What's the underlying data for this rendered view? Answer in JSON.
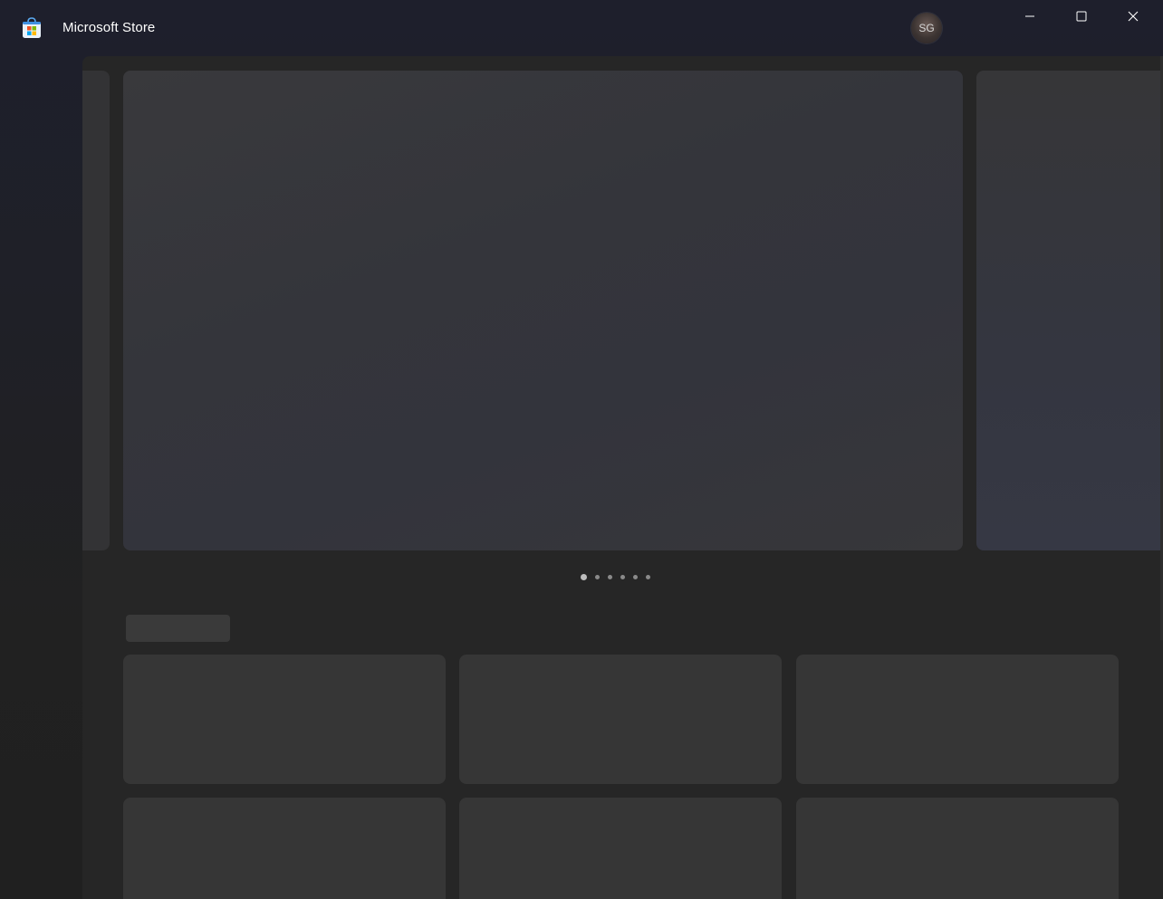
{
  "titlebar": {
    "app_title": "Microsoft Store",
    "app_icon": "microsoft-store-icon",
    "avatar_initials": "SG",
    "controls": {
      "minimize_icon": "minimize-icon",
      "maximize_icon": "maximize-icon",
      "close_icon": "close-icon"
    }
  },
  "carousel": {
    "slide_count": 6,
    "active_index": 0
  },
  "colors": {
    "content_background": "#262626",
    "card_placeholder": "#363636",
    "window_background": "#1f1f27"
  }
}
